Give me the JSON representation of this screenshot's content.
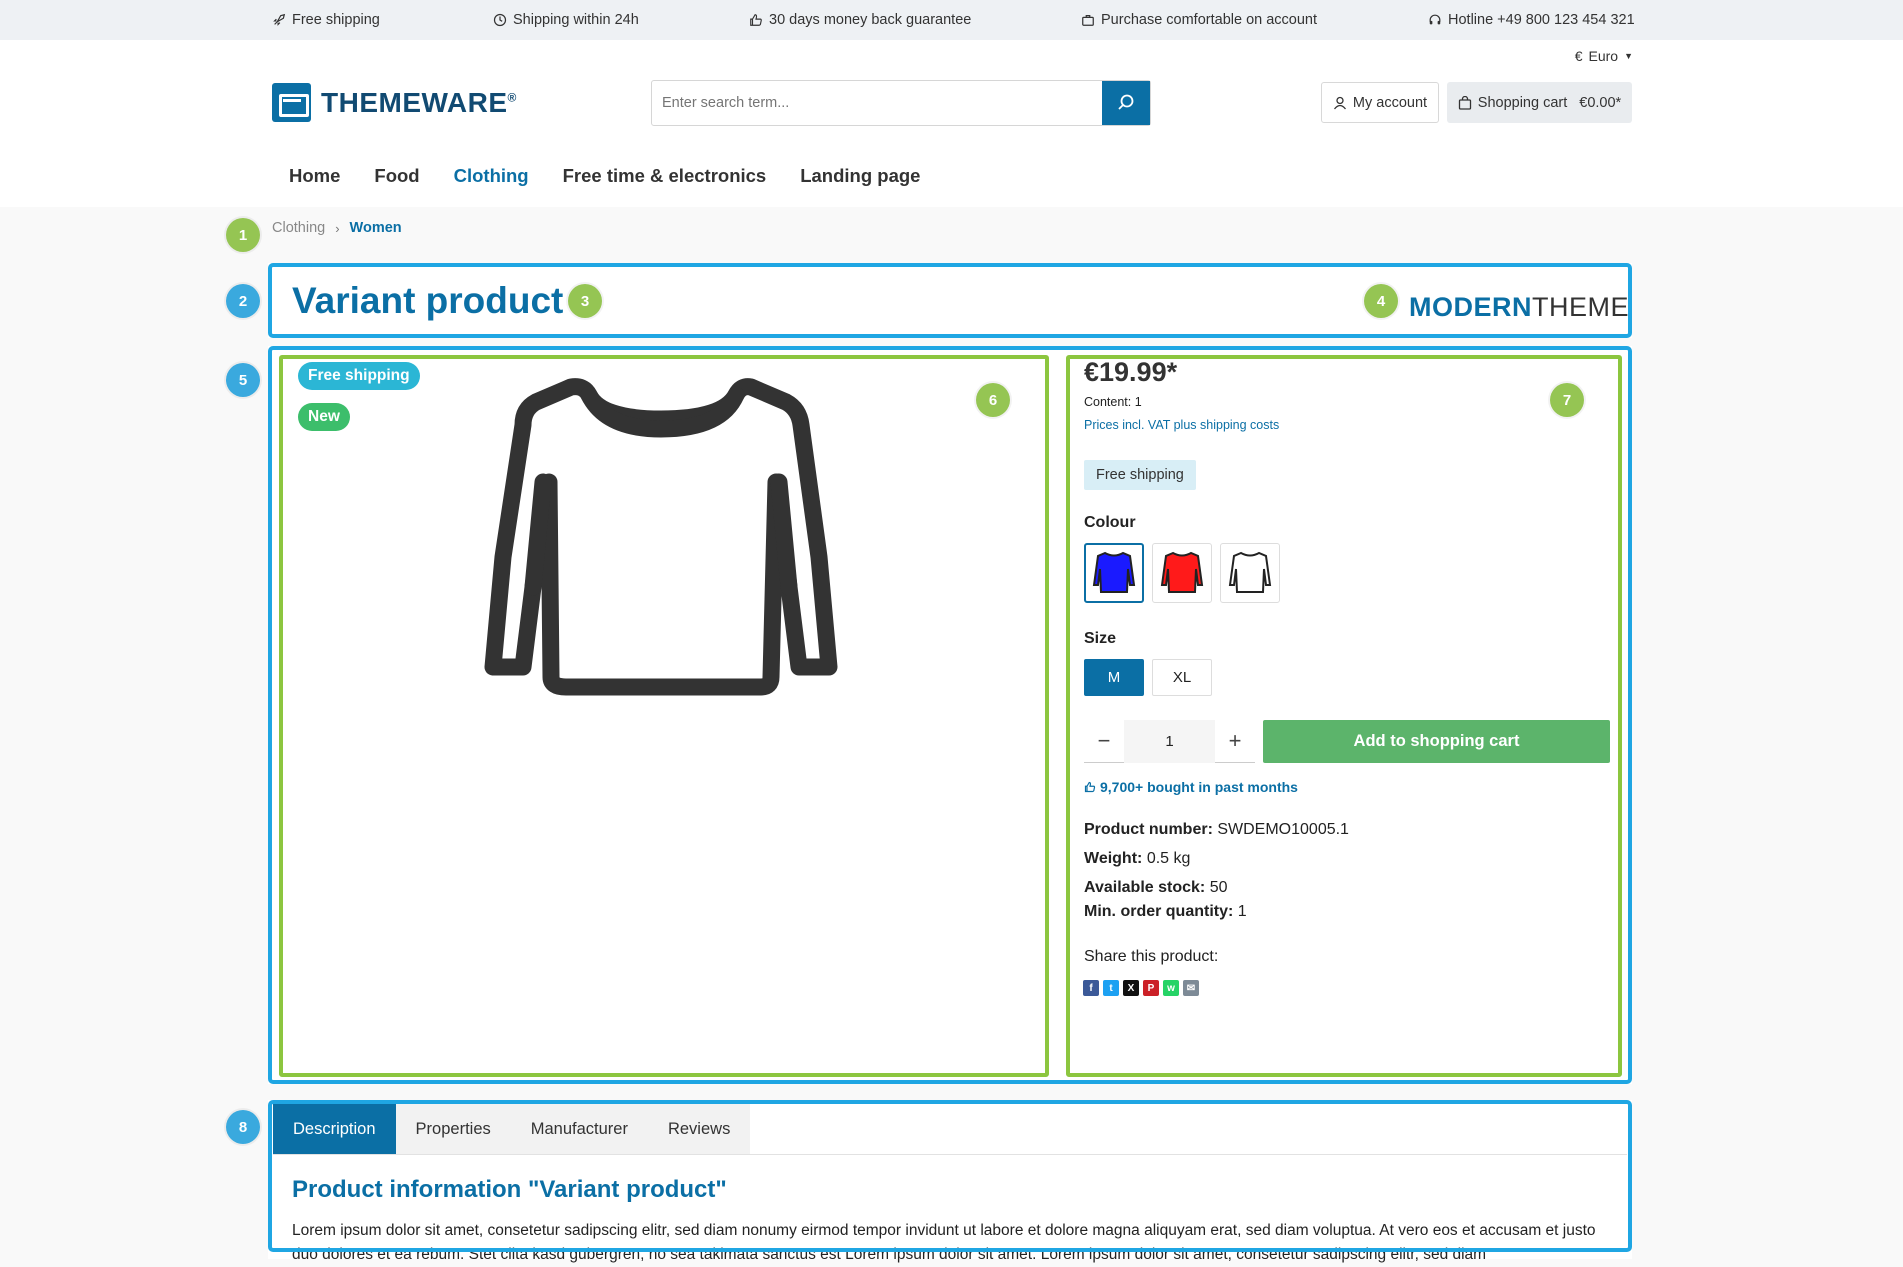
{
  "topbar": {
    "usps": [
      {
        "label": "Free shipping",
        "icon": "rocket-icon"
      },
      {
        "label": "Shipping within 24h",
        "icon": "clock-icon"
      },
      {
        "label": "30 days money back guarantee",
        "icon": "thumbs-up-icon"
      },
      {
        "label": "Purchase comfortable on account",
        "icon": "briefcase-icon"
      },
      {
        "label": "Hotline +49 800 123 454 321",
        "icon": "headset-icon"
      }
    ]
  },
  "header": {
    "currency_symbol": "€",
    "currency_label": "Euro",
    "logo_text": "THEMEWARE",
    "logo_reg": "®",
    "search_placeholder": "Enter search term...",
    "account_label": "My account",
    "cart_label": "Shopping cart",
    "cart_total": "€0.00*"
  },
  "nav": {
    "items": [
      {
        "label": "Home"
      },
      {
        "label": "Food"
      },
      {
        "label": "Clothing"
      },
      {
        "label": "Free time & electronics"
      },
      {
        "label": "Landing page"
      }
    ],
    "active": "Clothing"
  },
  "breadcrumb": {
    "items": [
      "Clothing",
      "Women"
    ]
  },
  "markers": [
    "1",
    "2",
    "3",
    "4",
    "5",
    "6",
    "7",
    "8"
  ],
  "product": {
    "title": "Variant product",
    "brand_part1": "MODERN",
    "brand_part2": "THEME",
    "badges": [
      "Free shipping",
      "New"
    ],
    "price": "€19.99*",
    "content": "Content: 1",
    "vat_note": "Prices incl. VAT plus shipping costs",
    "free_shipping_tag": "Free shipping",
    "colour_label": "Colour",
    "colours": [
      {
        "name": "blue",
        "hex": "#1a1aff",
        "selected": true
      },
      {
        "name": "red",
        "hex": "#ff1a1a",
        "selected": false
      },
      {
        "name": "white",
        "hex": "#ffffff",
        "selected": false
      }
    ],
    "size_label": "Size",
    "sizes": [
      {
        "label": "M",
        "selected": true
      },
      {
        "label": "XL",
        "selected": false
      }
    ],
    "quantity": "1",
    "qty_minus": "−",
    "qty_plus": "+",
    "add_to_cart": "Add to shopping cart",
    "bought": "9,700+ bought in past months",
    "details": {
      "number_label": "Product number:",
      "number": "SWDEMO10005.1",
      "weight_label": "Weight:",
      "weight": "0.5 kg",
      "stock_label": "Available stock:",
      "stock": "50",
      "min_label": "Min. order quantity:",
      "min": "1"
    },
    "share_label": "Share this product:",
    "share_icons": [
      {
        "name": "facebook-icon",
        "glyph": "f",
        "color": "#3b5998"
      },
      {
        "name": "twitter-icon",
        "glyph": "t",
        "color": "#1da1f2"
      },
      {
        "name": "x-icon",
        "glyph": "X",
        "color": "#111111"
      },
      {
        "name": "pinterest-icon",
        "glyph": "P",
        "color": "#cb2027"
      },
      {
        "name": "whatsapp-icon",
        "glyph": "w",
        "color": "#25d366"
      },
      {
        "name": "email-icon",
        "glyph": "✉",
        "color": "#7d8a96"
      }
    ]
  },
  "tabs": {
    "items": [
      {
        "label": "Description",
        "active": true
      },
      {
        "label": "Properties",
        "active": false
      },
      {
        "label": "Manufacturer",
        "active": false
      },
      {
        "label": "Reviews",
        "active": false
      }
    ],
    "desc_title": "Product information \"Variant product\"",
    "desc_text": "Lorem ipsum dolor sit amet, consetetur sadipscing elitr, sed diam nonumy eirmod tempor invidunt ut labore et dolore magna aliquyam erat, sed diam voluptua. At vero eos et accusam et justo duo dolores et ea rebum. Stet clita kasd gubergren, no sea takimata sanctus est Lorem ipsum dolor sit amet. Lorem ipsum dolor sit amet, consetetur sadipscing elitr, sed diam"
  },
  "colors": {
    "primary": "#0b6fa5",
    "add_to_cart": "#5cb46b",
    "marker_green": "#95c553",
    "marker_blue": "#3aa9de",
    "box_blue": "#1fa6e3",
    "box_green": "#8cc63f"
  }
}
